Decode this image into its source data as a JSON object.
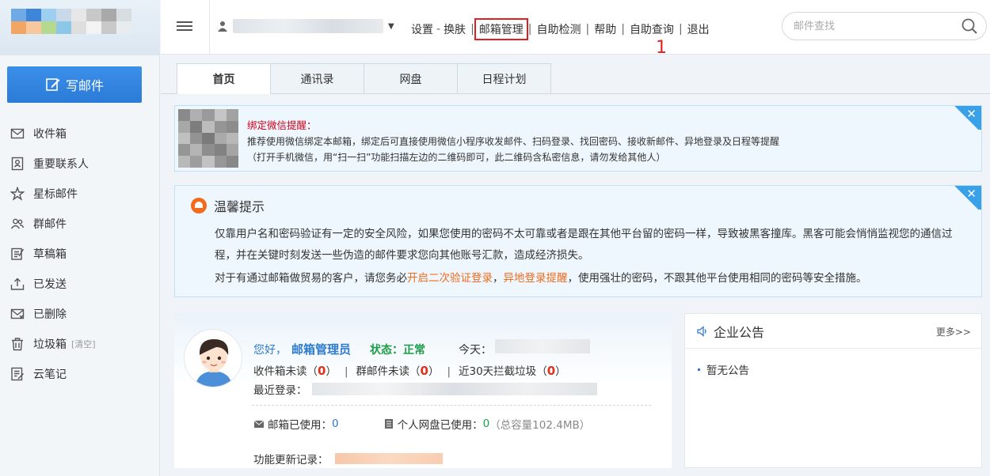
{
  "compose": {
    "label": "写邮件"
  },
  "sidebar": {
    "items": [
      {
        "label": "收件箱",
        "icon": "inbox-icon"
      },
      {
        "label": "重要联系人",
        "icon": "contact-card-icon"
      },
      {
        "label": "星标邮件",
        "icon": "star-icon"
      },
      {
        "label": "群邮件",
        "icon": "group-icon"
      },
      {
        "label": "草稿箱",
        "icon": "draft-icon"
      },
      {
        "label": "已发送",
        "icon": "sent-icon"
      },
      {
        "label": "已删除",
        "icon": "deleted-icon"
      },
      {
        "label": "垃圾箱",
        "icon": "trash-icon",
        "extra": "[清空]"
      },
      {
        "label": "云笔记",
        "icon": "note-icon"
      }
    ]
  },
  "topbar": {
    "links": {
      "settings": "设置",
      "skin": "换肤",
      "mailbox_admin": "邮箱管理",
      "self_check": "自助检测",
      "help": "帮助",
      "self_query": "自助查询",
      "logout": "退出"
    },
    "dash": "-",
    "sep": "|",
    "annotation": "1",
    "search_placeholder": "邮件查找",
    "accent_color": "#e02020"
  },
  "tabs": [
    "首页",
    "通讯录",
    "网盘",
    "日程计划"
  ],
  "wechat_notice": {
    "title": "绑定微信提醒：",
    "line1": "推荐使用微信绑定本邮箱，绑定后可直接使用微信小程序收发邮件、扫码登录、找回密码、接收新邮件、异地登录及日程等提醒",
    "line2": "（打开手机微信，用“扫一扫”功能扫描左边的二维码即可，此二维码含私密信息，请勿发给其他人）",
    "close": "✕"
  },
  "tip": {
    "title": "温馨提示",
    "p1": "仅靠用户名和密码验证有一定的安全风险，如果您使用的密码不太可靠或者是跟在其他平台留的密码一样，导致被黑客撞库。黑客可能会悄悄监视您的通信过程，并在关键时刻发送一些伪造的邮件要求您向其他账号汇款，造成经济损失。",
    "p2_pre": "对于有通过邮箱做贸易的客户，请您务必",
    "p2_link1": "开启二次验证登录",
    "p2_comma": "，",
    "p2_link2": "异地登录提醒",
    "p2_post": "，使用强壮的密码，不跟其他平台使用相同的密码等安全措施。",
    "close": "✕"
  },
  "user": {
    "hello": "您好，",
    "name": "邮箱管理员",
    "status": "状态：正常",
    "today": "今天：",
    "inbox_unread": "收件箱未读",
    "inbox_unread_count": "0",
    "group_unread": "群邮件未读",
    "group_unread_count": "0",
    "spam_30": "近30天拦截垃圾",
    "spam_30_count": "0",
    "last_login": "最近登录：",
    "mailbox_used_label": "邮箱已使用：",
    "mailbox_used": "0",
    "disk_used_label": "个人网盘已使用：",
    "disk_used": "0",
    "disk_total": "（总容量102.4MB）",
    "changelog": "功能更新记录："
  },
  "announce": {
    "title": "企业公告",
    "more": "更多>>",
    "items": [
      "暂无公告"
    ]
  }
}
